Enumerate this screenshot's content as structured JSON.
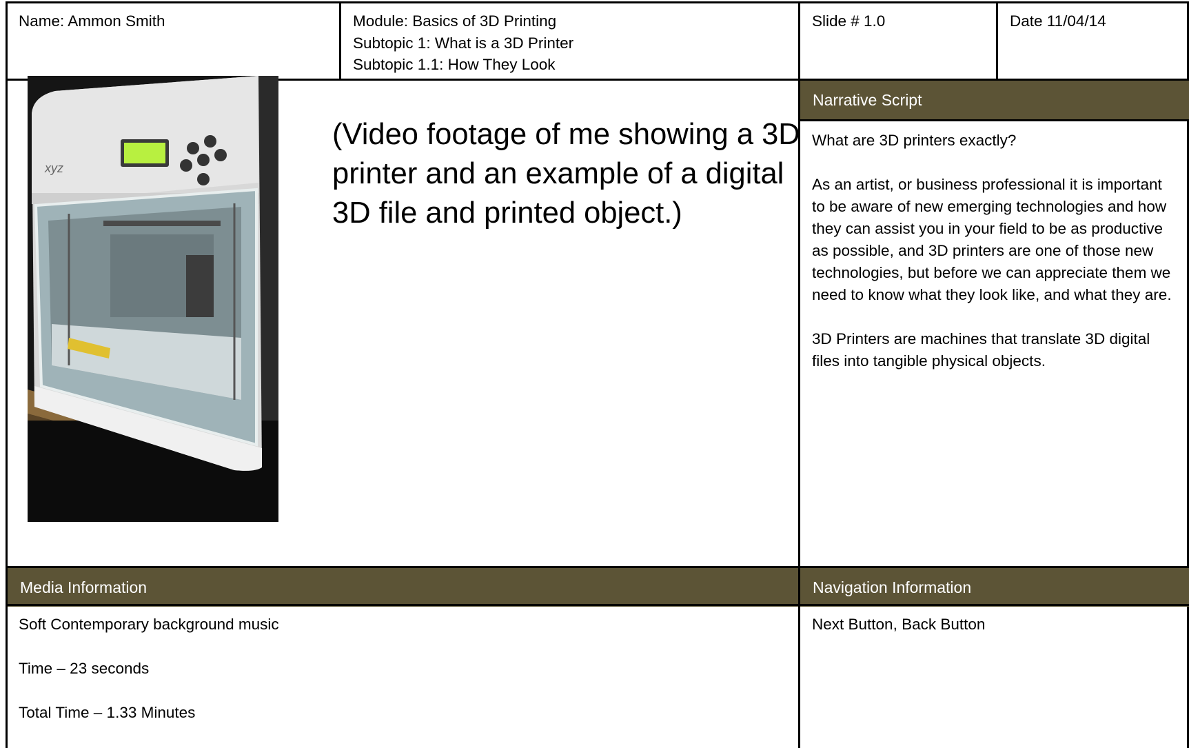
{
  "header": {
    "name": "Name: Ammon Smith",
    "module": "Module: Basics of 3D Printing",
    "subtopic1": "Subtopic 1: What is a 3D Printer",
    "subtopic11": "Subtopic 1.1: How They Look",
    "slide": "Slide # 1.0",
    "date": "Date 11/04/14"
  },
  "visual": {
    "description": "(Video footage of me showing a 3D printer and an example of a digital 3D file and printed object.)"
  },
  "narrative": {
    "title": "Narrative Script",
    "p1": "What are 3D printers exactly?",
    "p2": "As an artist, or business professional it is important to be aware of new emerging technologies and how they can assist you in your field to be as productive as possible, and 3D printers are one of those new technologies, but before we can appreciate them we need to know what they look like, and what they are.",
    "p3": "3D Printers are machines that translate 3D digital files into tangible physical objects."
  },
  "media": {
    "title": "Media Information",
    "line1": "Soft Contemporary background music",
    "line2": "Time – 23 seconds",
    "line3": "Total Time – 1.33 Minutes"
  },
  "navigation": {
    "title": "Navigation Information",
    "line1": "Next Button, Back Button"
  },
  "colors": {
    "band": "#5c5436",
    "printer_lcd": "#b8f040"
  }
}
